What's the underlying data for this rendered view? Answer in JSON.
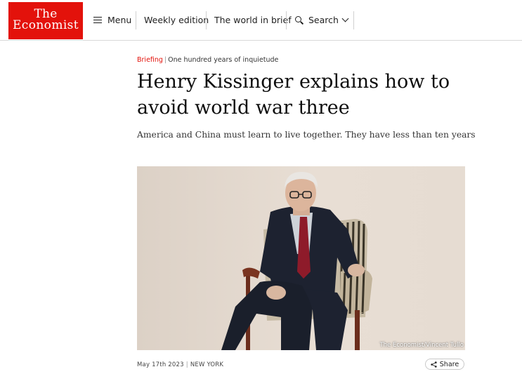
{
  "header": {
    "logo": {
      "line1": "The",
      "line2": "Economist",
      "color": "#e3120b"
    },
    "nav": {
      "menu_label": "Menu",
      "weekly_label": "Weekly edition",
      "world_label": "The world in brief",
      "search_label": "Search"
    }
  },
  "article": {
    "section": "Briefing",
    "series": "One hundred years of inquietude",
    "headline_line1": "Henry Kissinger explains how to",
    "headline_line2": "avoid world war three",
    "standfirst": "America and China must learn to live together. They have less than ten years",
    "image_credit": "The Economist/Vincent Tullo",
    "date": "May 17th 2023",
    "location": "NEW YORK",
    "share_label": "Share"
  }
}
